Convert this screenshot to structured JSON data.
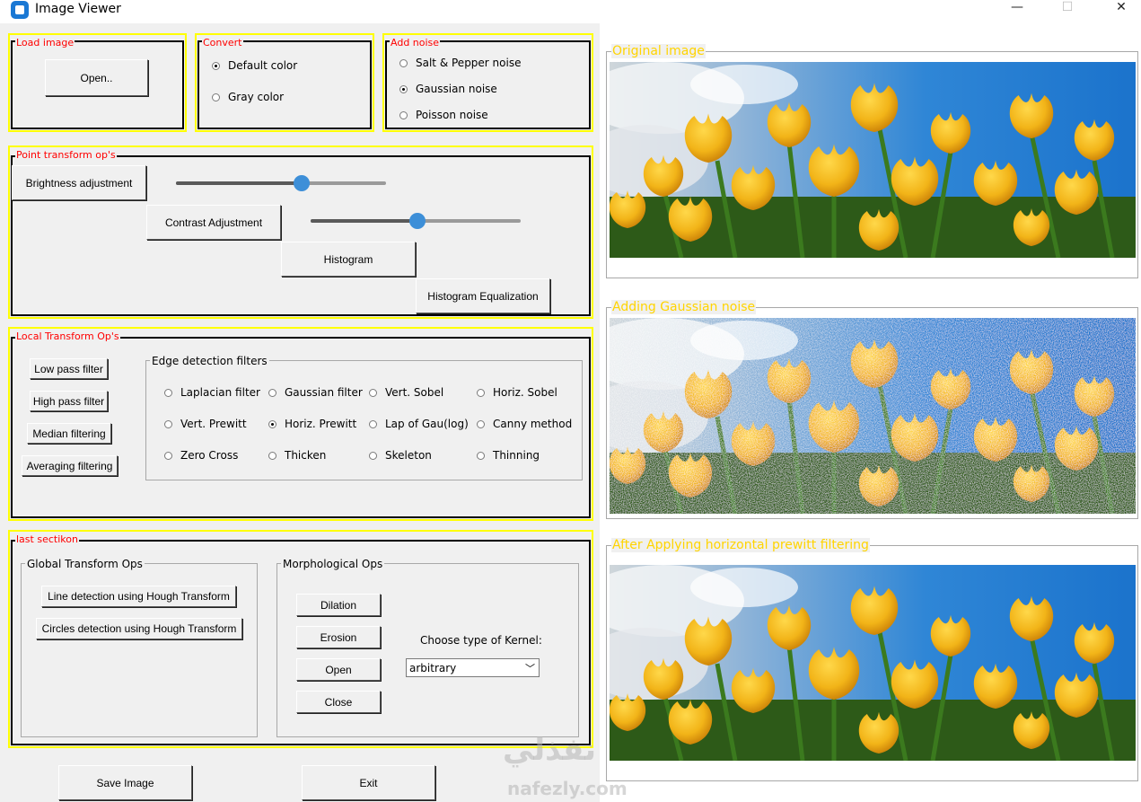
{
  "window": {
    "title": "Image Viewer",
    "minimize": "—",
    "maximize": "☐",
    "close": "✕"
  },
  "load_image": {
    "label": "Load image",
    "open_button": "Open.."
  },
  "convert": {
    "label": "Convert",
    "options": [
      {
        "label": "Default color",
        "selected": true
      },
      {
        "label": "Gray color",
        "selected": false
      }
    ]
  },
  "add_noise": {
    "label": "Add noise",
    "options": [
      {
        "label": "Salt & Pepper noise",
        "selected": false
      },
      {
        "label": "Gaussian noise",
        "selected": true
      },
      {
        "label": "Poisson noise",
        "selected": false
      }
    ]
  },
  "point_transform": {
    "label": "Point transform op's",
    "brightness_button": "Brightness adjustment",
    "brightness_level": 0.6,
    "contrast_button": "Contrast Adjustment",
    "contrast_level": 0.51,
    "histogram_button": "Histogram",
    "equalization_button": "Histogram Equalization"
  },
  "local_transform": {
    "label": "Local Transform Op's",
    "low_pass": "Low pass filter",
    "high_pass": "High pass filter",
    "median": "Median filtering",
    "averaging": "Averaging filtering",
    "edge_group_label": "Edge detection filters",
    "edge_filters": [
      {
        "label": "Laplacian filter",
        "selected": false
      },
      {
        "label": "Gaussian filter",
        "selected": false
      },
      {
        "label": "Vert. Sobel",
        "selected": false
      },
      {
        "label": "Horiz. Sobel",
        "selected": false
      },
      {
        "label": "Vert. Prewitt",
        "selected": false
      },
      {
        "label": "Horiz. Prewitt",
        "selected": true
      },
      {
        "label": "Lap of Gau(log)",
        "selected": false
      },
      {
        "label": "Canny method",
        "selected": false
      },
      {
        "label": "Zero Cross",
        "selected": false
      },
      {
        "label": "Thicken",
        "selected": false
      },
      {
        "label": "Skeleton",
        "selected": false
      },
      {
        "label": "Thinning",
        "selected": false
      }
    ]
  },
  "last_section": {
    "label": "last sectikon",
    "global_label": "Global Transform Ops",
    "line_detection": "Line detection using Hough Transform",
    "circle_detection": "Circles detection using Hough Transform",
    "morph_label": "Morphological Ops",
    "dilation": "Dilation",
    "erosion": "Erosion",
    "open": "Open",
    "close": "Close",
    "kernel_label": "Choose type of Kernel:",
    "kernel_value": "arbitrary"
  },
  "bottom": {
    "save_button": "Save Image",
    "exit_button": "Exit"
  },
  "panels": {
    "original": "Original image",
    "noisy": "Adding Gaussian noise",
    "filtered": "After Applying horizontal prewitt filtering"
  },
  "watermark": {
    "arabic": "نفذلي",
    "latin": "nafezly.com"
  },
  "colors": {
    "frame_highlight": "#ffff00",
    "frame_label": "#ff0000",
    "panel_label": "#ffd400",
    "slider_thumb": "#3d8fd8"
  }
}
